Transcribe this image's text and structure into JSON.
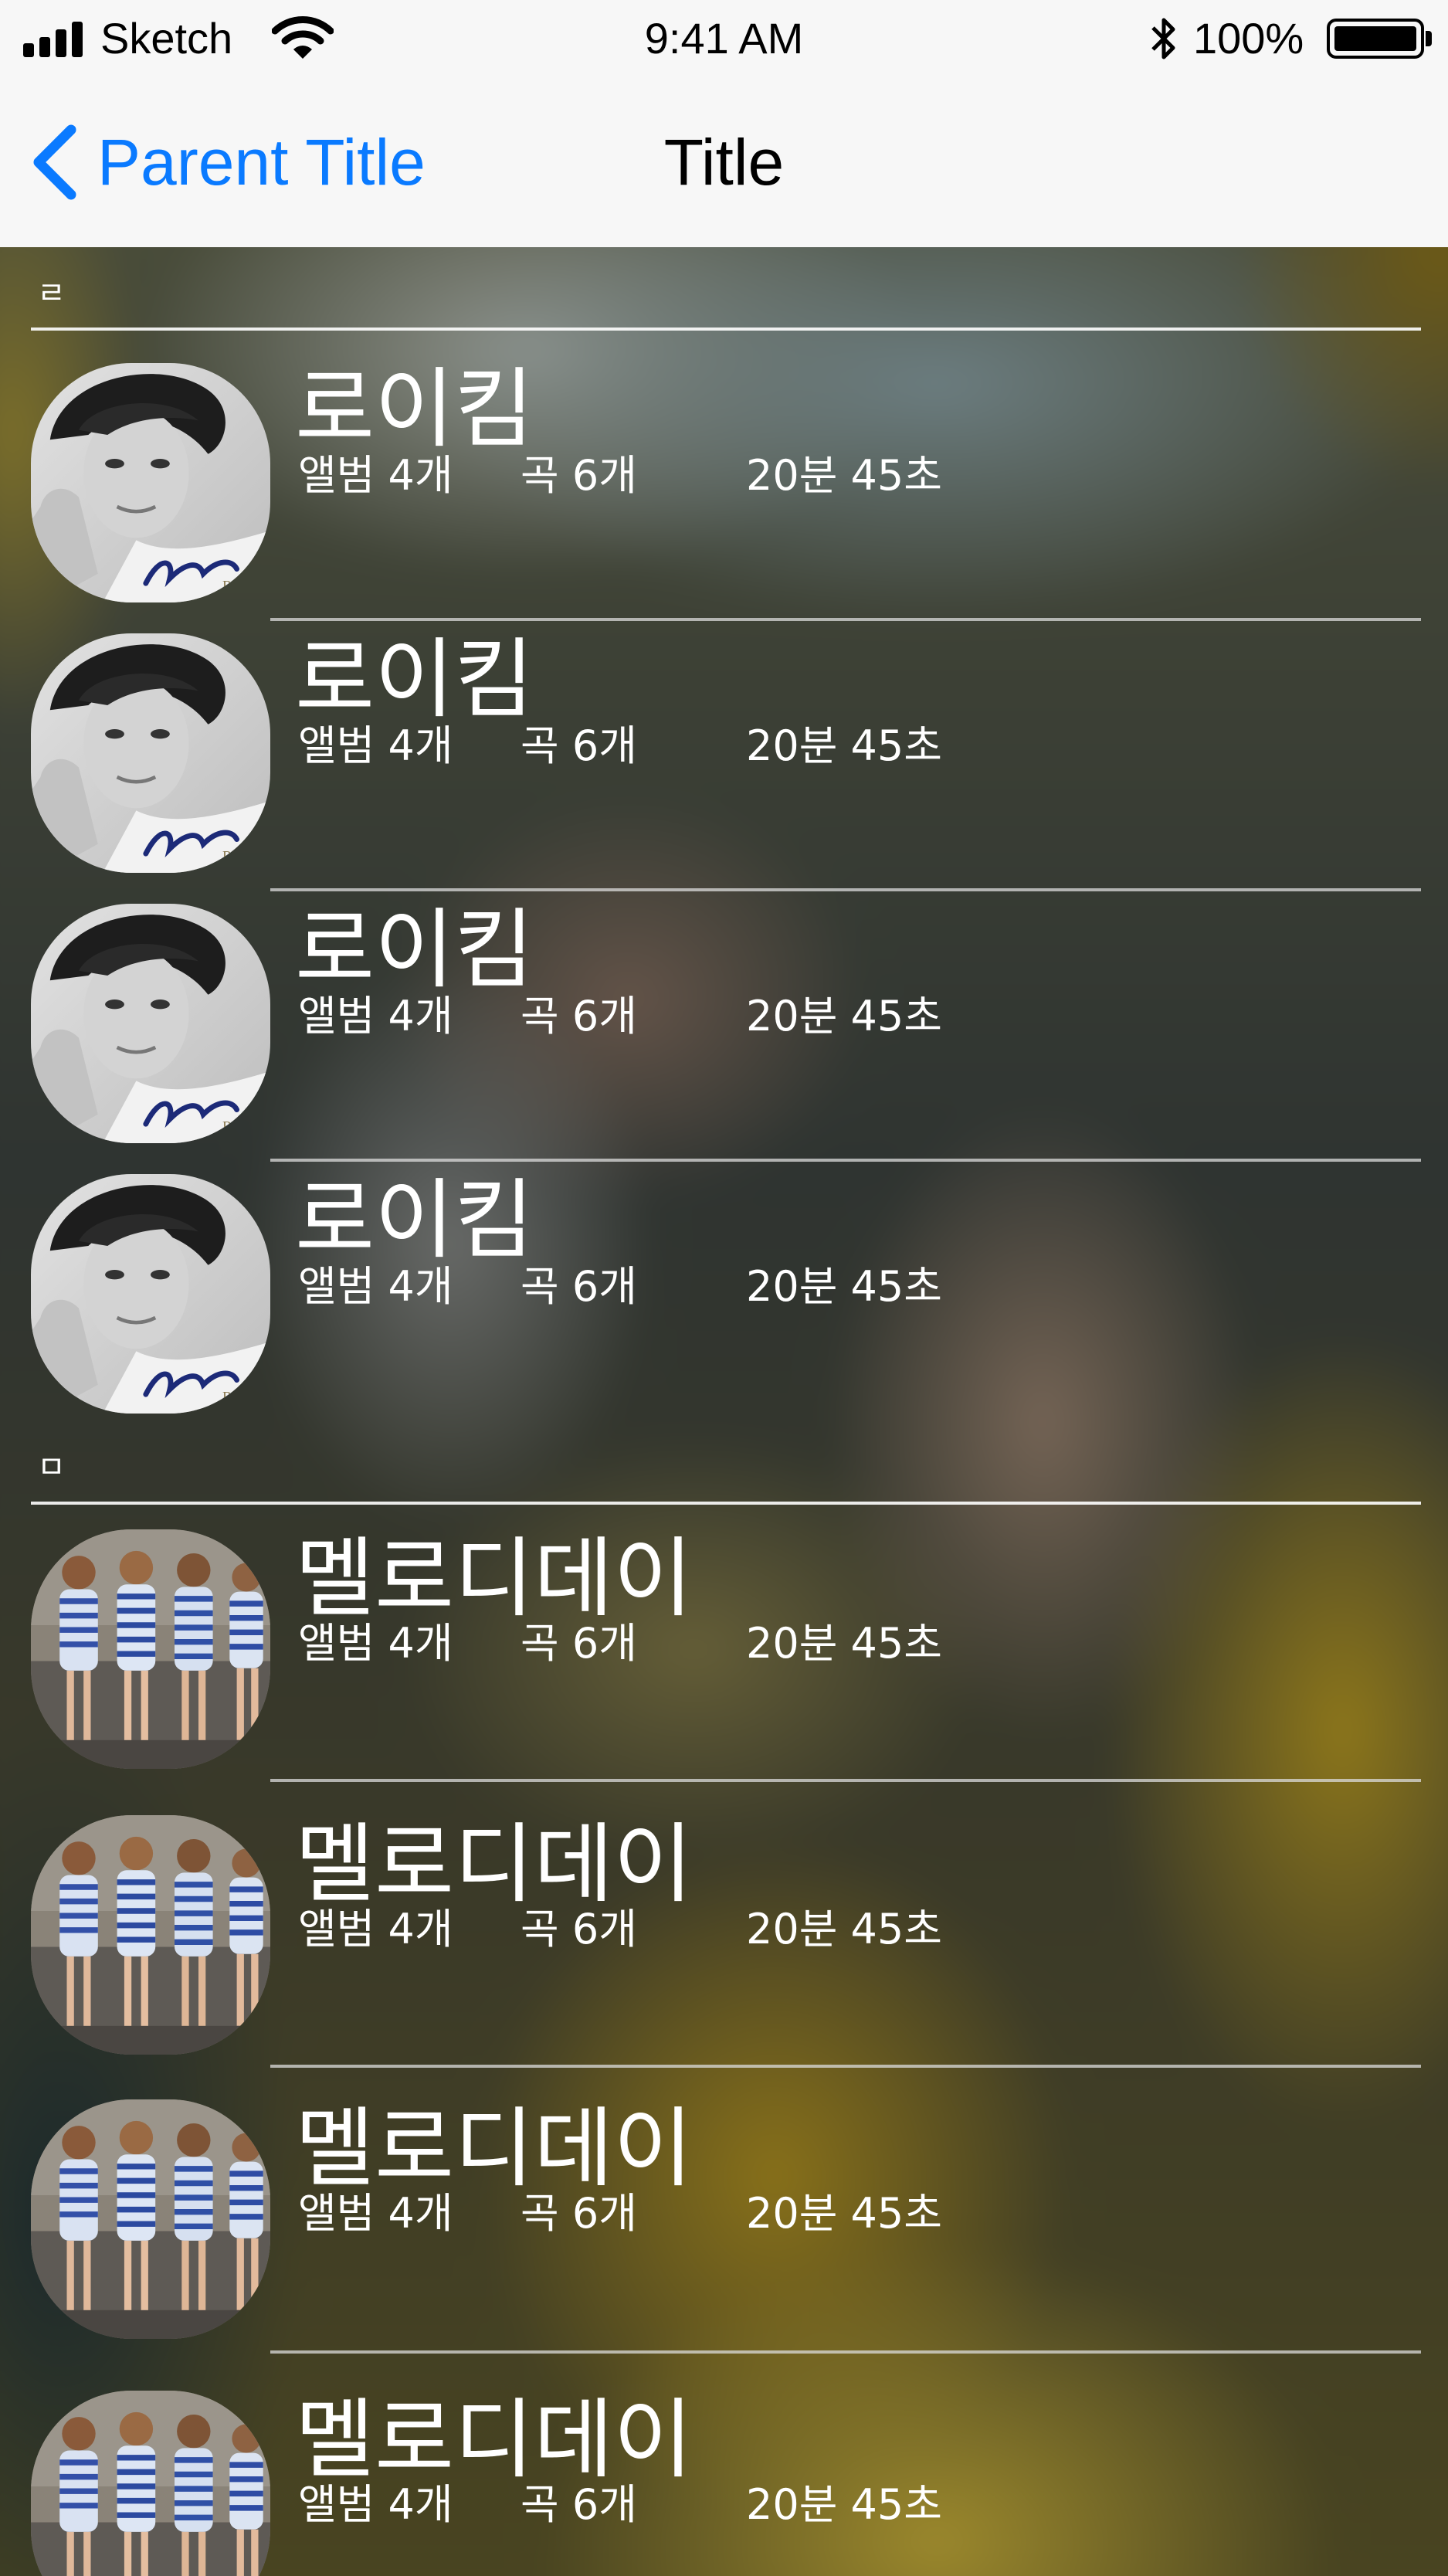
{
  "status_bar": {
    "carrier": "Sketch",
    "time": "9:41 AM",
    "battery_percent": "100%",
    "battery_level": 1.0,
    "icons": [
      "signal-icon",
      "wifi-icon",
      "bluetooth-icon",
      "battery-icon"
    ]
  },
  "nav": {
    "back_label": "Parent Title",
    "title": "Title",
    "accent_color": "#0a7aff"
  },
  "sections": [
    {
      "letter": "ㄹ",
      "rows": [
        {
          "name": "로이킴",
          "albums": "앨범 4개",
          "songs": "곡 6개",
          "duration": "20분 45초",
          "thumb": "roykim"
        },
        {
          "name": "로이킴",
          "albums": "앨범 4개",
          "songs": "곡 6개",
          "duration": "20분 45초",
          "thumb": "roykim"
        },
        {
          "name": "로이킴",
          "albums": "앨범 4개",
          "songs": "곡 6개",
          "duration": "20분 45초",
          "thumb": "roykim"
        },
        {
          "name": "로이킴",
          "albums": "앨범 4개",
          "songs": "곡 6개",
          "duration": "20분 45초",
          "thumb": "roykim"
        }
      ]
    },
    {
      "letter": "ㅁ",
      "rows": [
        {
          "name": "멜로디데이",
          "albums": "앨범 4개",
          "songs": "곡 6개",
          "duration": "20분 45초",
          "thumb": "melodyday"
        },
        {
          "name": "멜로디데이",
          "albums": "앨범 4개",
          "songs": "곡 6개",
          "duration": "20분 45초",
          "thumb": "melodyday"
        },
        {
          "name": "멜로디데이",
          "albums": "앨범 4개",
          "songs": "곡 6개",
          "duration": "20분 45초",
          "thumb": "melodyday"
        },
        {
          "name": "멜로디데이",
          "albums": "앨범 4개",
          "songs": "곡 6개",
          "duration": "20분 45초",
          "thumb": "melodyday"
        }
      ]
    }
  ]
}
